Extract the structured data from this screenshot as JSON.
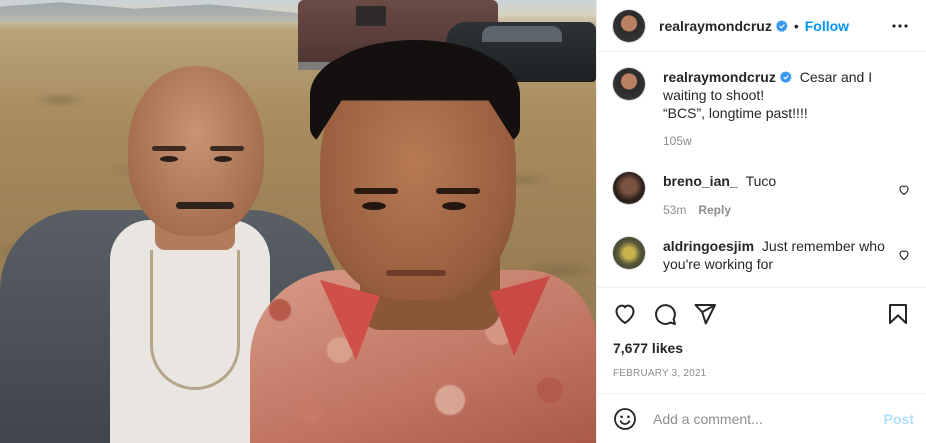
{
  "post": {
    "image_alt": "Two men posing outdoors in a desert field with a van and a car behind them",
    "author": {
      "username": "realraymondcruz",
      "verified": true,
      "separator": "•",
      "follow_label": "Follow",
      "more_icon": "more-options-icon"
    },
    "caption": {
      "username": "realraymondcruz",
      "text_line1": "Cesar and I",
      "text_line2": "waiting to shoot!",
      "text_line3": "“BCS”, longtime past!!!!",
      "age": "105w"
    },
    "comments": [
      {
        "username": "breno_ian_",
        "text": "Tuco",
        "age": "53m",
        "reply_label": "Reply"
      },
      {
        "username": "aldringoesjim",
        "text_line1": "Just remember who",
        "text_line2": "you're working for"
      }
    ],
    "actions": {
      "like_icon": "heart-icon",
      "comment_icon": "comment-icon",
      "share_icon": "send-icon",
      "save_icon": "bookmark-icon"
    },
    "likes": "7,677 likes",
    "date": "FEBRUARY 3, 2021",
    "add_comment": {
      "placeholder": "Add a comment...",
      "post_label": "Post",
      "emoji_icon": "emoji-icon"
    }
  },
  "colors": {
    "link_blue": "#0095f6",
    "verified_blue": "#3897f0",
    "muted_text": "#8e8e8e",
    "post_disabled": "#b2dffc"
  }
}
